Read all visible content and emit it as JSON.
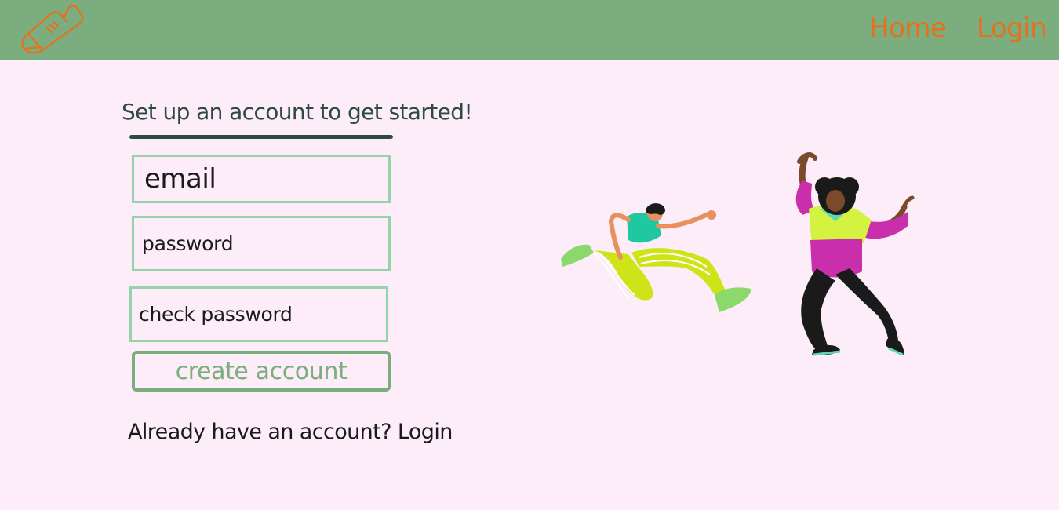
{
  "nav": {
    "logo_icon": "sneaker-icon",
    "home_label": "Home",
    "login_label": "Login"
  },
  "form": {
    "title": "Set up an account to get started!",
    "email_placeholder": "email",
    "password_placeholder": "password",
    "check_password_placeholder": "check password",
    "submit_label": "create account"
  },
  "footer": {
    "prompt": "Already have an account?",
    "login_link": "Login"
  },
  "illustration": {
    "icon": "dancing-people-illustration"
  },
  "colors": {
    "navbar_bg": "#7bad7e",
    "page_bg": "#fcedf8",
    "nav_link": "#e8701a",
    "field_border": "#96d3ad",
    "button": "#7bad7e",
    "title": "#2d4a3f"
  }
}
